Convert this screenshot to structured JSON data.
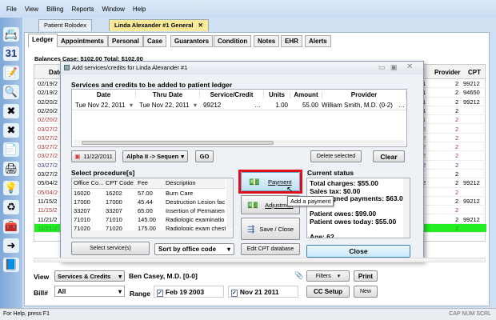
{
  "menu": [
    "File",
    "View",
    "Billing",
    "Reports",
    "Window",
    "Help"
  ],
  "doc_tabs": [
    {
      "label": "Patient Rolodex"
    },
    {
      "label": "Linda Alexander #1 General",
      "active": true
    }
  ],
  "inner_tabs": [
    "Ledger",
    "Appointments",
    "Personal",
    "Case",
    "Guarantors",
    "Condition",
    "Notes",
    "EHR",
    "Alerts"
  ],
  "balances": "Balances    Case: $102.00  Total: $102.00",
  "ledger": {
    "headers": {
      "date": "Date",
      "provider": "Provider",
      "cpt": "CPT"
    },
    "rows": [
      {
        "date": "02/19/2",
        "u": "1",
        "provider": "2",
        "cpt": "99212",
        "color": "normal"
      },
      {
        "date": "02/19/2",
        "u": "1",
        "provider": "2",
        "cpt": "94650",
        "color": "normal"
      },
      {
        "date": "02/20/2",
        "u": "1",
        "provider": "2",
        "cpt": "99212",
        "color": "normal"
      },
      {
        "date": "02/20/2",
        "u": "1",
        "provider": "2",
        "cpt": "",
        "color": "normal"
      },
      {
        "date": "02/20/2",
        "u": "1",
        "provider": "2",
        "cpt": "",
        "color": "red"
      },
      {
        "date": "03/27/2",
        "u": "2",
        "provider": "2",
        "cpt": "",
        "color": "red"
      },
      {
        "date": "03/27/2",
        "u": "2",
        "provider": "2",
        "cpt": "",
        "color": "red"
      },
      {
        "date": "03/27/2",
        "u": "2",
        "provider": "2",
        "cpt": "",
        "color": "red"
      },
      {
        "date": "03/27/2",
        "u": "2",
        "provider": "2",
        "cpt": "",
        "color": "red"
      },
      {
        "date": "03/27/2",
        "u": "2",
        "provider": "2",
        "cpt": "",
        "color": "blue"
      },
      {
        "date": "03/27/2",
        "u": "",
        "provider": "2",
        "cpt": "",
        "color": "normal"
      },
      {
        "date": "05/04/2",
        "u": "2",
        "provider": "2",
        "cpt": "99212",
        "color": "normal"
      },
      {
        "date": "05/04/2",
        "u": "",
        "provider": "2",
        "cpt": "",
        "color": "red"
      },
      {
        "date": "11/15/2",
        "u": "",
        "provider": "2",
        "cpt": "99212",
        "color": "normal"
      },
      {
        "date": "11/15/2",
        "u": "",
        "provider": "2",
        "cpt": "",
        "color": "red"
      },
      {
        "date": "11/21/2",
        "u": "",
        "provider": "2",
        "cpt": "99212",
        "color": "normal"
      },
      {
        "date": "11/21/2",
        "u": "",
        "provider": "2",
        "cpt": "",
        "color": "green"
      }
    ]
  },
  "dialog": {
    "title": "Add services/credits for Linda Alexander #1",
    "section_title": "Services and credits to be added to patient ledger",
    "grid_headers": [
      "Date",
      "Thru Date",
      "Service/Credit",
      "Units",
      "Amount",
      "Provider"
    ],
    "grid_row": {
      "date": "Tue Nov 22, 2011",
      "thru": "Tue Nov 22, 2011",
      "service": "99212",
      "units": "1.00",
      "amount": "55.00",
      "provider": "William Smith, M.D. (0-2)"
    },
    "date_button": "11/22/2011",
    "sort_select": "Alpha II -> Sequen",
    "go": "GO",
    "delete_selected": "Delete selected",
    "clear": "Clear",
    "select_procedures": "Select procedure[s]",
    "proc_headers": [
      "Office Co...",
      "CPT Code",
      "Fee",
      "Description"
    ],
    "procedures": [
      [
        "16020",
        "16202",
        "57.00",
        "Burn Care"
      ],
      [
        "17000",
        "17000",
        "45.44",
        "Destruction Lesion fac"
      ],
      [
        "33207",
        "33207",
        "65.00",
        "Insertion of Permanen"
      ],
      [
        "71010",
        "71010",
        "145.00",
        "Radiologic examinatio"
      ],
      [
        "71020",
        "71020",
        "175.00",
        "Radiologic exam chest"
      ]
    ],
    "select_services": "Select service(s)",
    "sort_by": "Sort by office code",
    "payment": "Payment",
    "adjustment": "Adjustmen",
    "save_close": "Save / Close",
    "edit_cpt": "Edit CPT database",
    "tooltip": "Add a payment",
    "current_status": "Current status",
    "status_lines": [
      "Total charges: $55.00",
      "Sales tax: $0.00",
      "Unassigned payments: $63.00",
      "",
      "Patient owes: $99.00",
      "Patient owes today: $55.00",
      "",
      "Age: 62"
    ],
    "close": "Close"
  },
  "bottom": {
    "view_label": "View",
    "view_value": "Services & Credits",
    "provider": "Ben Casey, M.D. [0-0]",
    "filters": "Filters",
    "print": "Print",
    "bill_label": "Bill#",
    "bill_value": "All",
    "range_label": "Range",
    "from": "Feb 19 2003",
    "to": "Nov 21 2011",
    "cc_setup": "CC Setup",
    "new": "New"
  },
  "statusbar": {
    "help": "For Help, press F1",
    "indicators": "CAP NUM SCRL"
  },
  "colors": {
    "highlight_red": "#e0101a",
    "green_row": "#22ee22",
    "accent": "#bfe4fb"
  }
}
